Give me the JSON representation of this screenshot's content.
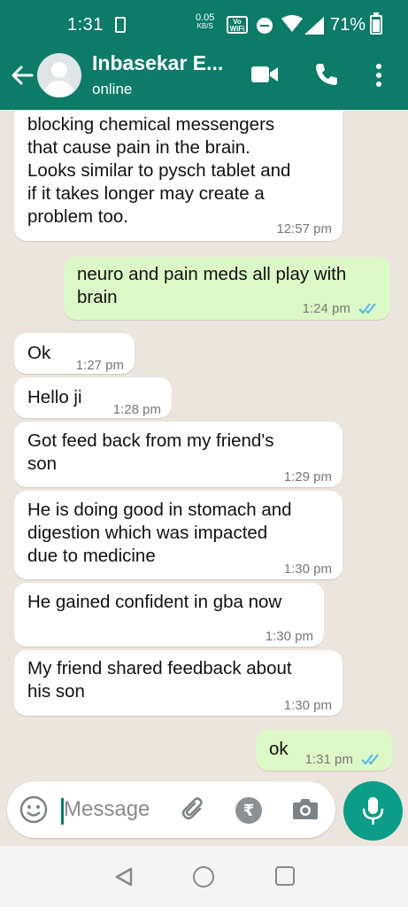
{
  "status_bar": {
    "time": "1:31",
    "speed_value": "0.05",
    "speed_unit": "KB/S",
    "volte_label": "Vo\nWiFi",
    "battery_percent": "71%"
  },
  "header": {
    "contact_name": "Inbasekar E...",
    "contact_status": "online",
    "icons": [
      "back-arrow-icon",
      "avatar",
      "video-call-icon",
      "voice-call-icon",
      "more-options-icon"
    ]
  },
  "messages": [
    {
      "direction": "in",
      "text": "blocking chemical messengers\nthat cause pain in the brain.\nLooks similar to pysch tablet and\nif it takes longer may create a\nproblem too.",
      "time": "12:57 pm"
    },
    {
      "direction": "out",
      "text": "neuro and pain meds all play with\nbrain",
      "time": "1:24 pm",
      "read": true
    },
    {
      "direction": "in",
      "text": "Ok",
      "time": "1:27 pm"
    },
    {
      "direction": "in",
      "text": "Hello ji",
      "time": "1:28 pm"
    },
    {
      "direction": "in",
      "text": "Got feed back from my friend's\nson",
      "time": "1:29 pm"
    },
    {
      "direction": "in",
      "text": "He is doing good in stomach and\ndigestion which was impacted\ndue to medicine",
      "time": "1:30 pm"
    },
    {
      "direction": "in",
      "text": "He gained confident in gba now",
      "time": "1:30 pm"
    },
    {
      "direction": "in",
      "text": "My friend shared feedback about\nhis son",
      "time": "1:30 pm"
    },
    {
      "direction": "out",
      "text": "ok",
      "time": "1:31 pm",
      "read": true
    }
  ],
  "composer": {
    "placeholder": "Message",
    "icons": [
      "emoji-icon",
      "attach-icon",
      "rupee-payment-icon",
      "camera-icon",
      "mic-icon"
    ]
  },
  "colors": {
    "header": "#0c7b68",
    "outgoing_bubble": "#dcf8c6",
    "incoming_bubble": "#ffffff",
    "read_ticks": "#4fb6ec",
    "mic_button": "#0c9d88"
  }
}
